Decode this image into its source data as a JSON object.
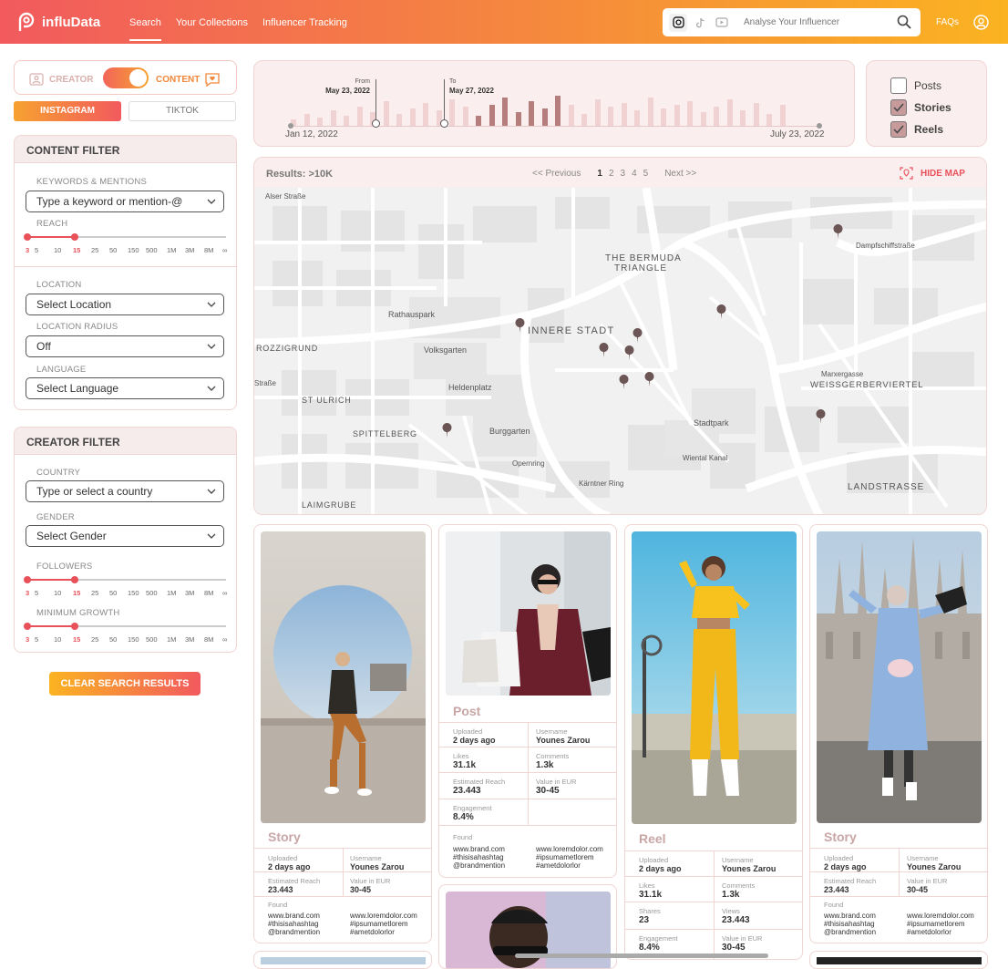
{
  "header": {
    "logo_text": "influData",
    "nav": [
      "Search",
      "Your Collections",
      "Influencer Tracking"
    ],
    "search_placeholder": "Analyse Your Influencer",
    "faq": "FAQs"
  },
  "mode": {
    "creator_label": "CREATOR",
    "content_label": "CONTENT",
    "mode_selected": "content"
  },
  "platform_tabs": {
    "instagram": "INSTAGRAM",
    "tiktok": "TIKTOK"
  },
  "content_filter": {
    "title": "CONTENT FILTER",
    "keywords_label": "KEYWORDS & MENTIONS",
    "keywords_placeholder": "Type a keyword or mention-@",
    "reach_label": "REACH",
    "ticks": [
      "3",
      "5",
      "10",
      "15",
      "25",
      "50",
      "150",
      "500",
      "1M",
      "3M",
      "8M",
      "∞"
    ],
    "location_label": "LOCATION",
    "location_value": "Select Location",
    "radius_label": "LOCATION RADIUS",
    "radius_value": "Off",
    "language_label": "LANGUAGE",
    "language_value": "Select Language"
  },
  "creator_filter": {
    "title": "CREATOR FILTER",
    "country_label": "COUNTRY",
    "country_value": "Type or select a country",
    "gender_label": "GENDER",
    "gender_value": "Select Gender",
    "followers_label": "FOLLOWERS",
    "growth_label": "MINIMUM GROWTH"
  },
  "clear_button": "CLEAR SEARCH RESULTS",
  "timeline": {
    "start": "Jan 12, 2022",
    "end": "July 23, 2022",
    "from_label": "From",
    "from_date": "May 23, 2022",
    "to_label": "To",
    "to_date": "May 27, 2022"
  },
  "content_types": [
    {
      "label": "Posts",
      "checked": false
    },
    {
      "label": "Stories",
      "checked": true
    },
    {
      "label": "Reels",
      "checked": true
    }
  ],
  "results": {
    "count": "Results: >10K",
    "prev": "<< Previous",
    "pages": [
      "1",
      "2",
      "3",
      "4",
      "5"
    ],
    "next": "Next >>",
    "hide_map": "HIDE MAP"
  },
  "map_labels": {
    "bermuda1": "THE BERMUDA",
    "bermuda2": "TRIANGLE",
    "innere": "INNERE STADT",
    "rathauspark": "Rathauspark",
    "volksgarten": "Volksgarten",
    "heldenplatz": "Heldenplatz",
    "burggarten": "Burggarten",
    "rozzigrund": "ROZZIGRUND",
    "ulrich": "ST ULRICH",
    "spittelberg": "SPITTELBERG",
    "laimgrube": "LAIMGRUBE",
    "weiss": "WEISSGERBERVIERTEL",
    "landstrasse": "LANDSTRASSE",
    "stadtpark": "Stadtpark",
    "wiental": "Wiental Kanal",
    "alser": "Alser Straße",
    "dampf": "Dampfschiffstraße",
    "opernring": "Opernring",
    "kaerntner": "Kärntner Ring",
    "marxer": "Marxergasse",
    "strasse": "Straße"
  },
  "labels": {
    "uploaded": "Uploaded",
    "username": "Username",
    "est_reach": "Estimated Reach",
    "value_eur": "Value in EUR",
    "likes": "Likes",
    "comments": "Comments",
    "engagement": "Engagement",
    "shares": "Shares",
    "views": "Views",
    "found": "Found"
  },
  "cards": {
    "story1": {
      "type": "Story",
      "uploaded": "2 days ago",
      "username": "Younes Zarou",
      "reach": "23.443",
      "value": "30-45"
    },
    "post": {
      "type": "Post",
      "uploaded": "2 days ago",
      "username": "Younes Zarou",
      "likes": "31.1k",
      "comments": "1.3k",
      "reach": "23.443",
      "value": "30-45",
      "engagement": "8.4%"
    },
    "reel": {
      "type": "Reel",
      "uploaded": "2 days ago",
      "username": "Younes Zarou",
      "likes": "31.1k",
      "comments": "1.3k",
      "shares": "23",
      "views": "23.443",
      "engagement": "8.4%",
      "value": "30-45"
    },
    "story2": {
      "type": "Story",
      "uploaded": "2 days ago",
      "username": "Younes Zarou",
      "reach": "23.443",
      "value": "30-45"
    }
  },
  "found": {
    "col1": [
      "www.brand.com",
      "#thisisahashtag",
      "@brandmention"
    ],
    "col2": [
      "www.loremdolor.com",
      "#ipsumametlorem",
      "#ametdolorlor"
    ]
  },
  "colors": {
    "accent_red": "#f25a5e",
    "accent_orange": "#fbb321",
    "panel_pink": "#fbeeee"
  }
}
